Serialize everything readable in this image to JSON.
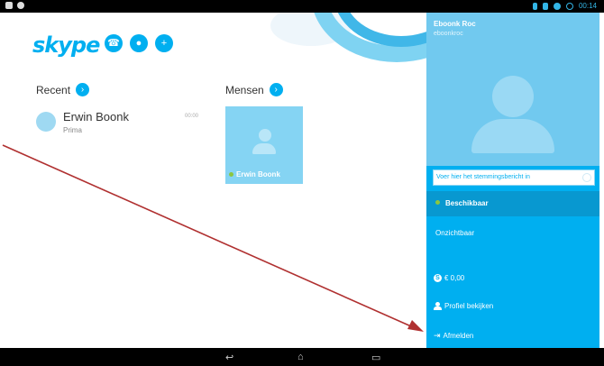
{
  "app": {
    "logo": "skype"
  },
  "header_buttons": [
    {
      "name": "call",
      "icon": "phone-icon",
      "glyph": "☎"
    },
    {
      "name": "chat",
      "icon": "chat-icon",
      "glyph": "●"
    },
    {
      "name": "add-contact",
      "icon": "add-contact-icon",
      "glyph": "+"
    }
  ],
  "recent": {
    "title": "Recent",
    "contact": {
      "name": "Erwin Boonk",
      "mood": "Prima",
      "time": "00:00"
    }
  },
  "people": {
    "title": "Mensen",
    "tile_name": "Erwin Boonk"
  },
  "profile": {
    "display_name": "Eboonk Roc",
    "handle": "eboonkroc",
    "mood_placeholder": "Voer hier het stemmingsbericht in",
    "status_options": [
      "Beschikbaar",
      "Onzichtbaar"
    ],
    "selected_status": "Beschikbaar",
    "credit": "€ 0,00",
    "view_profile": "Profiel bekijken",
    "logout": "Afmelden"
  },
  "statusbar": {
    "time": "00:14"
  },
  "colors": {
    "skype_blue": "#00aff0",
    "panel_selected": "#0898d0",
    "online_green": "#8cc63f",
    "annotation_arrow": "#b03030"
  }
}
